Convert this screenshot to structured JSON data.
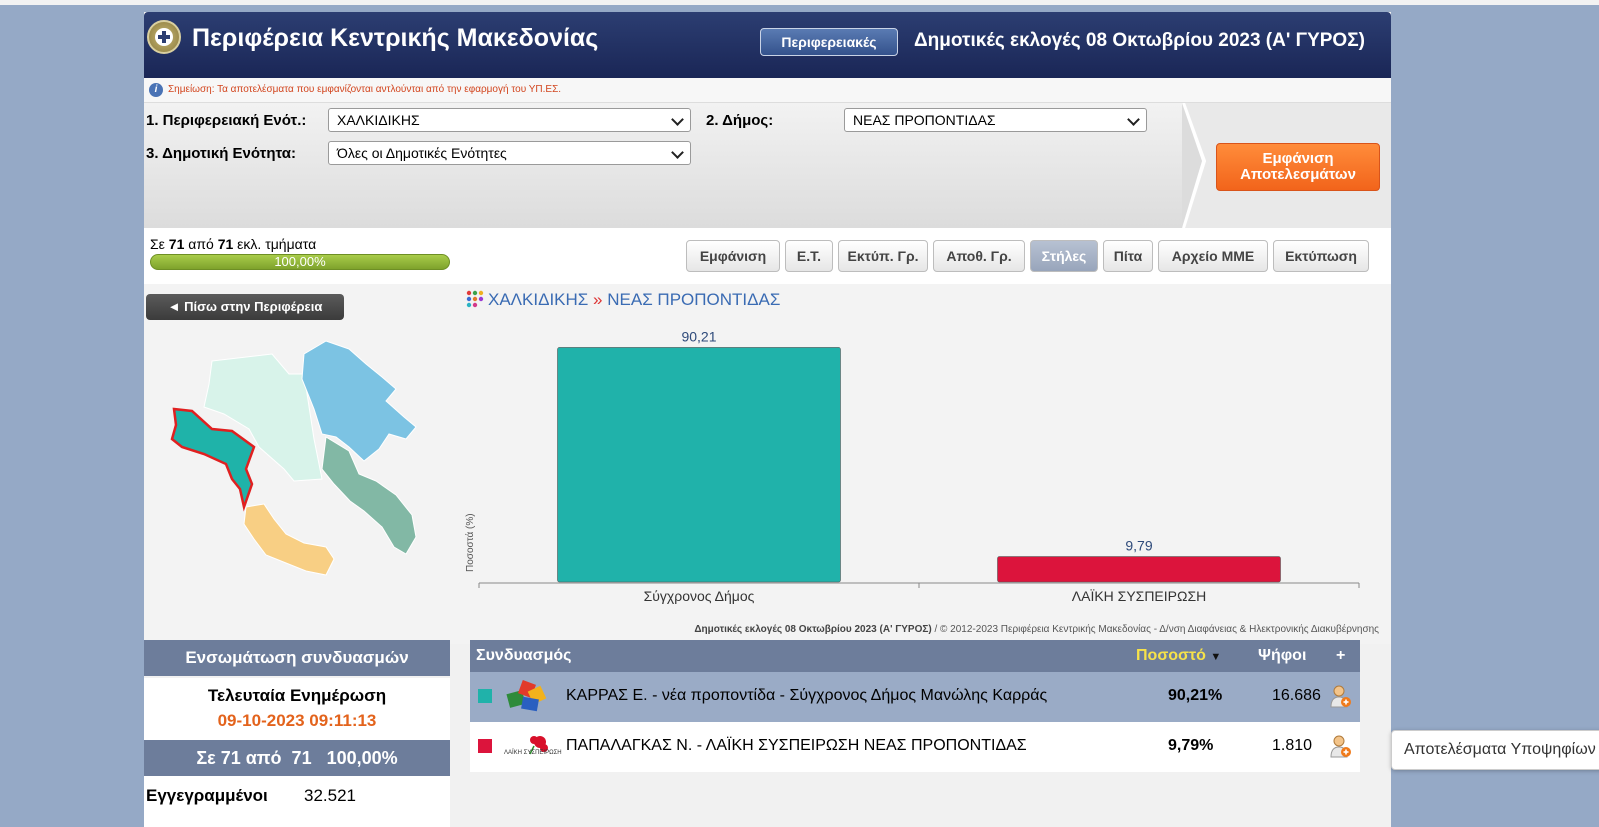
{
  "header": {
    "title": "Περιφέρεια Κεντρικής Μακεδονίας",
    "nav_button": "Περιφερειακές",
    "election": "Δημοτικές εκλογές 08 Οκτωβρίου 2023 (Α' ΓΥΡΟΣ)"
  },
  "note": "Σημείωση: Τα αποτελέσματα που εμφανίζονται αντλούνται από την εφαρμογή του ΥΠ.ΕΣ.",
  "filters": {
    "label1": "1. Περιφερειακή Ενότ.:",
    "value1": "ΧΑΛΚΙΔΙΚΗΣ",
    "label2": "2. Δήμος:",
    "value2": "ΝΕΑΣ ΠΡΟΠΟΝΤΙΔΑΣ",
    "label3": "3. Δημοτική Ενότητα:",
    "value3": "Όλες οι Δημοτικές Ενότητες",
    "show_line1": "Εμφάνιση",
    "show_line2": "Αποτελεσμάτων"
  },
  "progress": {
    "prefix": "Σε",
    "counted": "71",
    "middle": "από",
    "total": "71",
    "suffix": "εκλ. τμήματα",
    "percent_label": "100,00%",
    "fraction": 1.0
  },
  "tabs": [
    {
      "label": "Εμφάνιση",
      "active": false
    },
    {
      "label": "Ε.Τ.",
      "active": false
    },
    {
      "label": "Εκτύπ. Γρ.",
      "active": false
    },
    {
      "label": "Αποθ. Γρ.",
      "active": false
    },
    {
      "label": "Στήλες",
      "active": true
    },
    {
      "label": "Πίτα",
      "active": false
    },
    {
      "label": "Αρχείο ΜΜΕ",
      "active": false
    },
    {
      "label": "Εκτύπωση",
      "active": false
    }
  ],
  "back_button": "◄ Πίσω στην Περιφέρεια",
  "breadcrumb": {
    "part1": "ΧΑΛΚΙΔΙΚΗΣ",
    "sep": "»",
    "part2": "ΝΕΑΣ ΠΡΟΠΟΝΤΙΔΑΣ"
  },
  "chart_data": {
    "type": "bar",
    "categories": [
      "Σύγχρονος Δήμος",
      "ΛΑΪΚΗ ΣΥΣΠΕΙΡΩΣΗ"
    ],
    "values": [
      90.21,
      9.79
    ],
    "value_labels": [
      "90,21",
      "9,79"
    ],
    "colors": [
      "#20b2aa",
      "#dc143c"
    ],
    "ylabel": "Ποσοστά (%)",
    "ylim": [
      0,
      100
    ],
    "grid": false
  },
  "credit": {
    "bold": "Δημοτικές εκλογές 08 Οκτωβρίου 2023 (Α' ΓΥΡΟΣ)",
    "rest": " / © 2012-2023 Περιφέρεια Κεντρικής Μακεδονίας - Δ/νση Διαφάνειας & Ηλεκτρονικής Διακυβέρνησης"
  },
  "side": {
    "head1": "Ενσωμάτωση συνδυασμών",
    "last_update_label": "Τελευταία Ενημέρωση",
    "last_update": "09-10-2023 09:11:13",
    "head2": "Σε 71 από  71   100,00%",
    "registered_label": "Εγγεγραμμένοι",
    "registered": "32.521"
  },
  "table": {
    "col_combination": "Συνδυασμός",
    "col_percent": "Ποσοστό",
    "col_votes": "Ψήφοι",
    "col_add": "+",
    "rows": [
      {
        "name": "ΚΑΡΡΑΣ Ε. - νέα προποντίδα - Σύγχρονος Δήμος Μανώλης Καρράς",
        "percent": "90,21%",
        "votes": "16.686",
        "color": "#20b2aa",
        "logo": "puzzle-logo"
      },
      {
        "name": "ΠΑΠΑΛΑΓΚΑΣ Ν. - ΛΑΪΚΗ ΣΥΣΠΕΙΡΩΣΗ ΝΕΑΣ ΠΡΟΠΟΝΤΙΔΑΣ",
        "percent": "9,79%",
        "votes": "1.810",
        "color": "#dc143c",
        "logo": "laiki-syspeirosi-logo",
        "logo_text": "ΛΑΪΚΗ ΣΥΣΠΕΙΡΩΣΗ"
      }
    ]
  },
  "tooltip": "Αποτελέσματα Υποψηφίων"
}
